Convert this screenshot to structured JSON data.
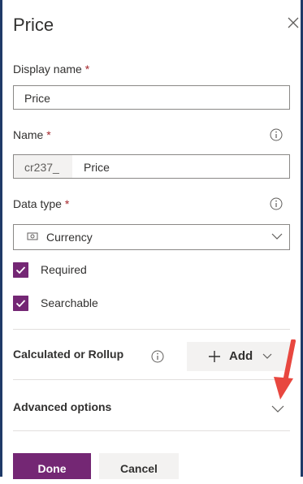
{
  "panel": {
    "title": "Price"
  },
  "display_name": {
    "label": "Display name",
    "required_mark": "*",
    "value": "Price"
  },
  "name": {
    "label": "Name",
    "required_mark": "*",
    "prefix": "cr237_",
    "value": "Price"
  },
  "data_type": {
    "label": "Data type",
    "required_mark": "*",
    "selected": "Currency"
  },
  "options": {
    "required_label": "Required",
    "required_checked": true,
    "searchable_label": "Searchable",
    "searchable_checked": true
  },
  "calculated": {
    "label": "Calculated or Rollup",
    "add_label": "Add"
  },
  "advanced": {
    "label": "Advanced options"
  },
  "footer": {
    "done_label": "Done",
    "cancel_label": "Cancel"
  },
  "colors": {
    "accent": "#742774",
    "frame": "#1f3a68",
    "annotation_arrow": "#e8473f"
  }
}
